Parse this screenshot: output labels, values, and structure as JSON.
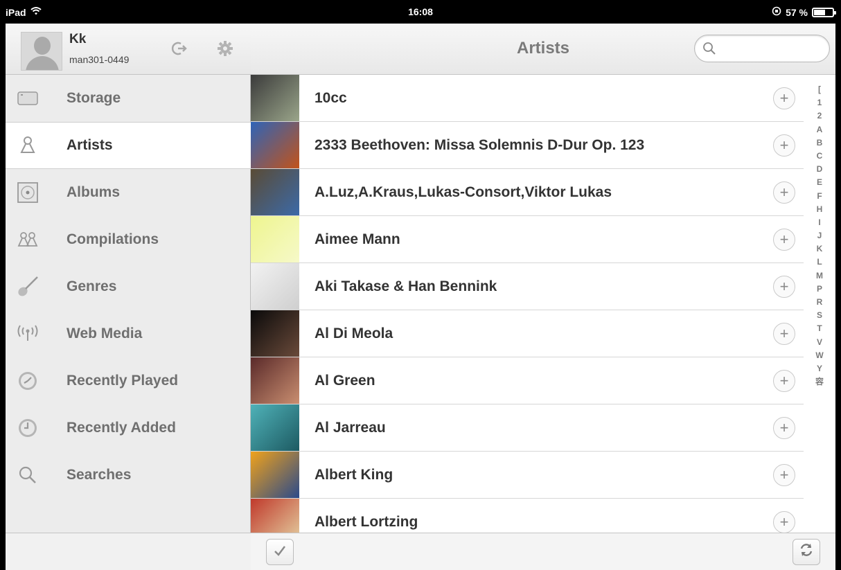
{
  "status_bar": {
    "device": "iPad",
    "time": "16:08",
    "battery": "57 %",
    "battery_level": 0.57
  },
  "sidebar": {
    "user": {
      "name": "Kk",
      "account": "man301-0449"
    },
    "items": [
      {
        "label": "Storage",
        "icon": "storage-icon",
        "active": false
      },
      {
        "label": "Artists",
        "icon": "artist-icon",
        "active": true
      },
      {
        "label": "Albums",
        "icon": "album-icon",
        "active": false
      },
      {
        "label": "Compilations",
        "icon": "compilations-icon",
        "active": false
      },
      {
        "label": "Genres",
        "icon": "guitar-icon",
        "active": false
      },
      {
        "label": "Web Media",
        "icon": "web-media-icon",
        "active": false
      },
      {
        "label": "Recently Played",
        "icon": "recently-played-icon",
        "active": false
      },
      {
        "label": "Recently Added",
        "icon": "recently-added-icon",
        "active": false
      },
      {
        "label": "Searches",
        "icon": "search-icon",
        "active": false
      }
    ]
  },
  "main": {
    "title": "Artists",
    "search_placeholder": "",
    "artists": [
      {
        "name": "10cc",
        "thumb_colors": [
          "#3b3b3b",
          "#9aa58a"
        ]
      },
      {
        "name": "2333 Beethoven: Missa Solemnis D-Dur Op. 123",
        "thumb_colors": [
          "#2e64b8",
          "#c2531a"
        ]
      },
      {
        "name": "A.Luz,A.Kraus,Lukas-Consort,Viktor Lukas",
        "thumb_colors": [
          "#5a4b35",
          "#3c6aa8"
        ]
      },
      {
        "name": "Aimee Mann",
        "thumb_colors": [
          "#eef58f",
          "#f6f9c8"
        ]
      },
      {
        "name": "Aki Takase & Han Bennink",
        "thumb_colors": [
          "#f2f2f2",
          "#cfcfcf"
        ]
      },
      {
        "name": "Al Di Meola",
        "thumb_colors": [
          "#0a0a0a",
          "#6a4a3a"
        ]
      },
      {
        "name": "Al Green",
        "thumb_colors": [
          "#5a2a2a",
          "#c98e70"
        ]
      },
      {
        "name": "Al Jarreau",
        "thumb_colors": [
          "#4fb2b8",
          "#1d5a62"
        ]
      },
      {
        "name": "Albert King",
        "thumb_colors": [
          "#f0a21b",
          "#2b4a8a"
        ]
      },
      {
        "name": "Albert Lortzing",
        "thumb_colors": [
          "#c0392b",
          "#e5d3a4"
        ]
      }
    ],
    "index_letters": [
      "[",
      "1",
      "2",
      "A",
      "B",
      "C",
      "D",
      "E",
      "F",
      "H",
      "I",
      "J",
      "K",
      "L",
      "M",
      "P",
      "R",
      "S",
      "T",
      "V",
      "W",
      "Y",
      "容"
    ]
  }
}
